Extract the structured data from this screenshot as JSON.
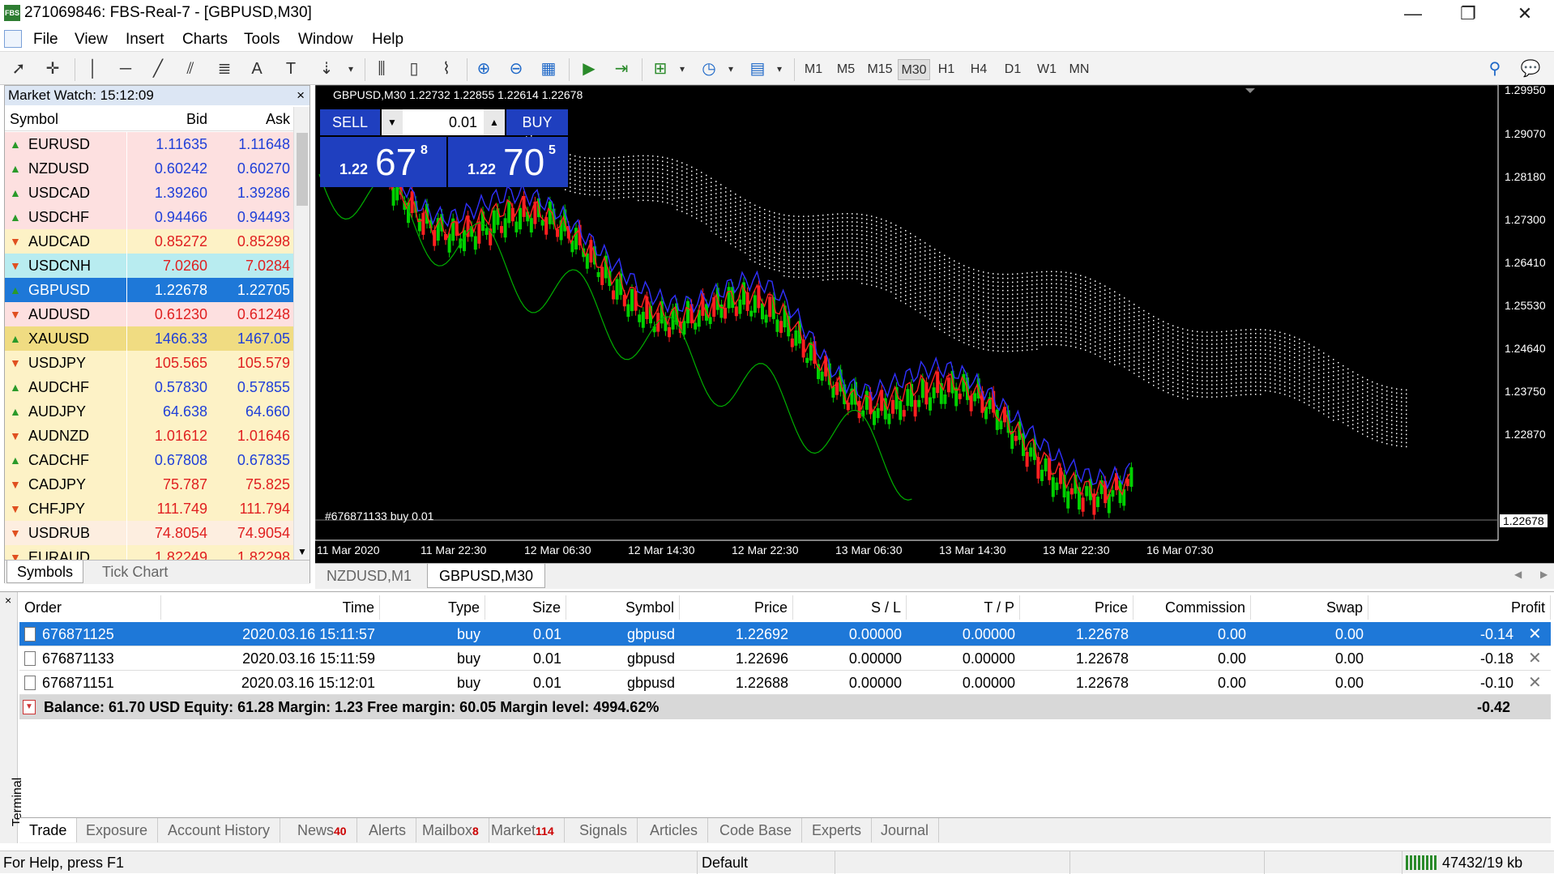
{
  "window": {
    "title": "271069846: FBS-Real-7 - [GBPUSD,M30]",
    "minimize": "—",
    "restore": "❐",
    "close": "✕"
  },
  "menu": [
    "File",
    "View",
    "Insert",
    "Charts",
    "Tools",
    "Window",
    "Help"
  ],
  "timeframes": [
    "M1",
    "M5",
    "M15",
    "M30",
    "H1",
    "H4",
    "D1",
    "W1",
    "MN"
  ],
  "market_watch": {
    "title": "Market Watch: 15:12:09",
    "close": "×",
    "columns": [
      "Symbol",
      "Bid",
      "Ask"
    ],
    "rows": [
      {
        "symbol": "EURUSD",
        "bid": "1.11635",
        "ask": "1.11648",
        "dir": "up",
        "bg": "#fde0e0",
        "fg": "#1f3fd8"
      },
      {
        "symbol": "NZDUSD",
        "bid": "0.60242",
        "ask": "0.60270",
        "dir": "up",
        "bg": "#fde0e0",
        "fg": "#1f3fd8"
      },
      {
        "symbol": "USDCAD",
        "bid": "1.39260",
        "ask": "1.39286",
        "dir": "up",
        "bg": "#fde0e0",
        "fg": "#1f3fd8"
      },
      {
        "symbol": "USDCHF",
        "bid": "0.94466",
        "ask": "0.94493",
        "dir": "up",
        "bg": "#fde0e0",
        "fg": "#1f3fd8"
      },
      {
        "symbol": "AUDCAD",
        "bid": "0.85272",
        "ask": "0.85298",
        "dir": "down",
        "bg": "#fdf2c6",
        "fg": "#e02020"
      },
      {
        "symbol": "USDCNH",
        "bid": "7.0260",
        "ask": "7.0284",
        "dir": "down",
        "bg": "#b8ecf0",
        "fg": "#e02020"
      },
      {
        "symbol": "GBPUSD",
        "bid": "1.22678",
        "ask": "1.22705",
        "dir": "up",
        "bg": "#1e78d8",
        "fg": "#ffffff",
        "selected": true
      },
      {
        "symbol": "AUDUSD",
        "bid": "0.61230",
        "ask": "0.61248",
        "dir": "down",
        "bg": "#fde0e0",
        "fg": "#e02020"
      },
      {
        "symbol": "XAUUSD",
        "bid": "1466.33",
        "ask": "1467.05",
        "dir": "up",
        "bg": "#f0dc82",
        "fg": "#1f3fd8"
      },
      {
        "symbol": "USDJPY",
        "bid": "105.565",
        "ask": "105.579",
        "dir": "down",
        "bg": "#fdf2c6",
        "fg": "#e02020"
      },
      {
        "symbol": "AUDCHF",
        "bid": "0.57830",
        "ask": "0.57855",
        "dir": "up",
        "bg": "#fdf2c6",
        "fg": "#1f3fd8"
      },
      {
        "symbol": "AUDJPY",
        "bid": "64.638",
        "ask": "64.660",
        "dir": "up",
        "bg": "#fdf2c6",
        "fg": "#1f3fd8"
      },
      {
        "symbol": "AUDNZD",
        "bid": "1.01612",
        "ask": "1.01646",
        "dir": "down",
        "bg": "#fdf2c6",
        "fg": "#e02020"
      },
      {
        "symbol": "CADCHF",
        "bid": "0.67808",
        "ask": "0.67835",
        "dir": "up",
        "bg": "#fdf2c6",
        "fg": "#1f3fd8"
      },
      {
        "symbol": "CADJPY",
        "bid": "75.787",
        "ask": "75.825",
        "dir": "down",
        "bg": "#fdf2c6",
        "fg": "#e02020"
      },
      {
        "symbol": "CHFJPY",
        "bid": "111.749",
        "ask": "111.794",
        "dir": "down",
        "bg": "#fdf2c6",
        "fg": "#e02020"
      },
      {
        "symbol": "USDRUB",
        "bid": "74.8054",
        "ask": "74.9054",
        "dir": "down",
        "bg": "#fdeee0",
        "fg": "#e02020"
      },
      {
        "symbol": "EURAUD",
        "bid": "1.82249",
        "ask": "1.82298",
        "dir": "down",
        "bg": "#fdf2c6",
        "fg": "#e02020"
      }
    ],
    "tabs": [
      "Symbols",
      "Tick Chart"
    ]
  },
  "chart": {
    "header": "GBPUSD,M30  1.22732 1.22855 1.22614 1.22678",
    "sell_label": "SELL",
    "buy_label": "BUY",
    "lot": "0.01",
    "sell_price_prefix": "1.22",
    "sell_price_big": "67",
    "sell_price_sup": "8",
    "buy_price_prefix": "1.22",
    "buy_price_big": "70",
    "buy_price_sup": "5",
    "trade_label": "#676871133 buy 0.01",
    "price_ticks": [
      "1.29950",
      "1.29070",
      "1.28180",
      "1.27300",
      "1.26410",
      "1.25530",
      "1.24640",
      "1.23750",
      "1.22870"
    ],
    "current_price": "1.22678",
    "time_ticks": [
      "11 Mar 2020",
      "11 Mar 22:30",
      "12 Mar 06:30",
      "12 Mar 14:30",
      "12 Mar 22:30",
      "13 Mar 06:30",
      "13 Mar 14:30",
      "13 Mar 22:30",
      "16 Mar 07:30"
    ]
  },
  "chart_tabs": [
    "NZDUSD,M1",
    "GBPUSD,M30"
  ],
  "terminal": {
    "label": "Terminal",
    "columns": [
      "Order",
      "Time",
      "Type",
      "Size",
      "Symbol",
      "Price",
      "S / L",
      "T / P",
      "Price",
      "Commission",
      "Swap",
      "Profit"
    ],
    "rows": [
      {
        "order": "676871125",
        "time": "2020.03.16 15:11:57",
        "type": "buy",
        "size": "0.01",
        "symbol": "gbpusd",
        "price": "1.22692",
        "sl": "0.00000",
        "tp": "0.00000",
        "cur": "1.22678",
        "commission": "0.00",
        "swap": "0.00",
        "profit": "-0.14",
        "selected": true
      },
      {
        "order": "676871133",
        "time": "2020.03.16 15:11:59",
        "type": "buy",
        "size": "0.01",
        "symbol": "gbpusd",
        "price": "1.22696",
        "sl": "0.00000",
        "tp": "0.00000",
        "cur": "1.22678",
        "commission": "0.00",
        "swap": "0.00",
        "profit": "-0.18"
      },
      {
        "order": "676871151",
        "time": "2020.03.16 15:12:01",
        "type": "buy",
        "size": "0.01",
        "symbol": "gbpusd",
        "price": "1.22688",
        "sl": "0.00000",
        "tp": "0.00000",
        "cur": "1.22678",
        "commission": "0.00",
        "swap": "0.00",
        "profit": "-0.10"
      }
    ],
    "summary": "Balance: 61.70 USD  Equity: 61.28  Margin: 1.23  Free margin: 60.05  Margin level: 4994.62%",
    "summary_profit": "-0.42",
    "tabs": [
      {
        "label": "Trade",
        "badge": ""
      },
      {
        "label": "Exposure",
        "badge": ""
      },
      {
        "label": "Account History",
        "badge": ""
      },
      {
        "label": "News",
        "badge": "40"
      },
      {
        "label": "Alerts",
        "badge": ""
      },
      {
        "label": "Mailbox",
        "badge": "8"
      },
      {
        "label": "Market",
        "badge": "114"
      },
      {
        "label": "Signals",
        "badge": ""
      },
      {
        "label": "Articles",
        "badge": ""
      },
      {
        "label": "Code Base",
        "badge": ""
      },
      {
        "label": "Experts",
        "badge": ""
      },
      {
        "label": "Journal",
        "badge": ""
      }
    ]
  },
  "status": {
    "help": "For Help, press F1",
    "profile": "Default",
    "traffic": "47432/19 kb"
  }
}
